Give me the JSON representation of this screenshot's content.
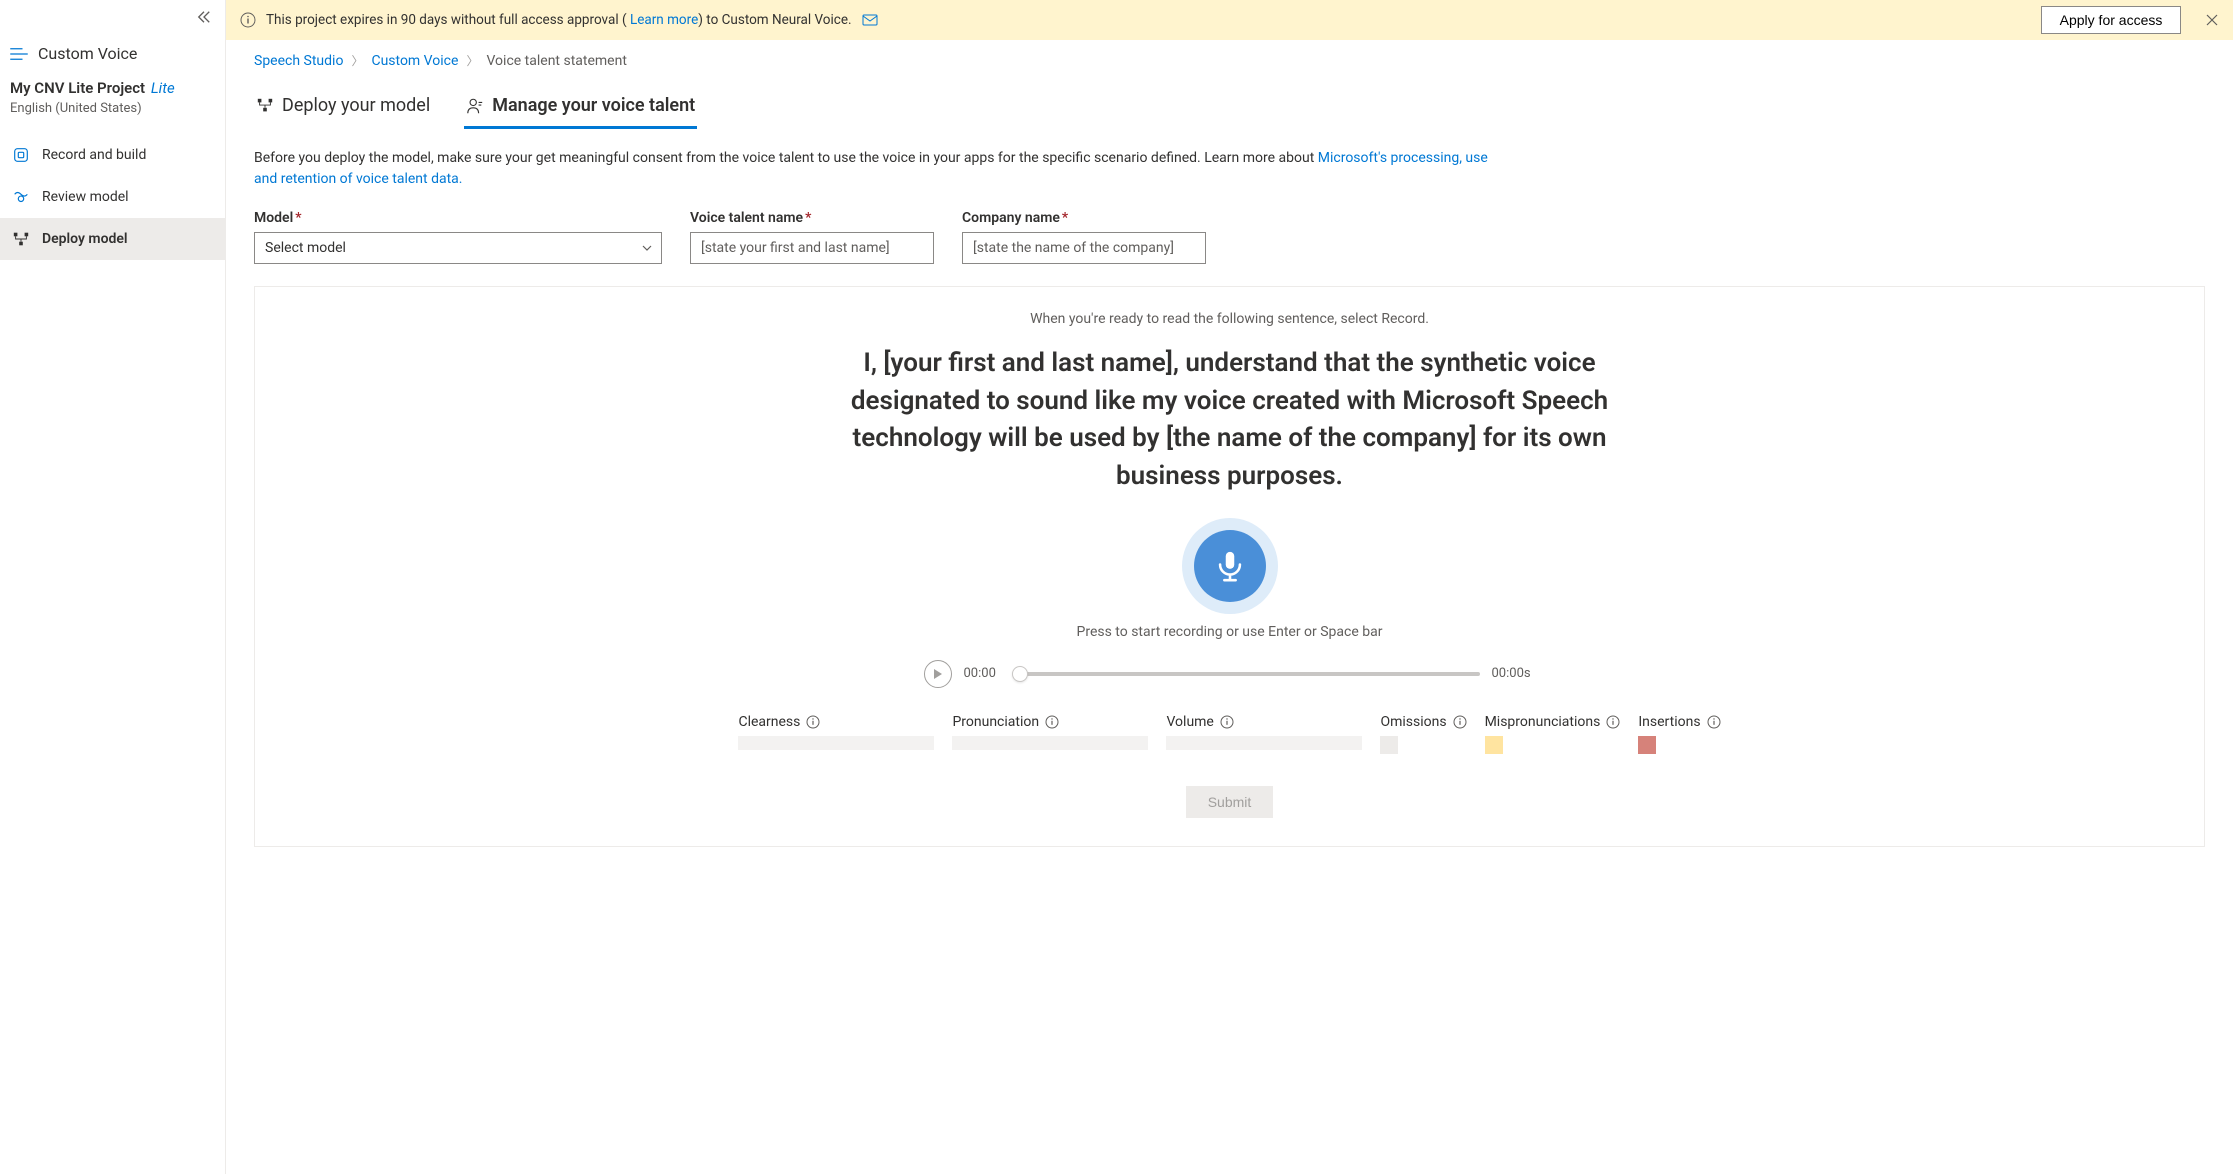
{
  "sidebar": {
    "app_name": "Custom Voice",
    "project_name": "My CNV Lite Project",
    "project_badge": "Lite",
    "project_lang": "English (United States)",
    "nav": [
      {
        "label": "Record and build",
        "id": "record"
      },
      {
        "label": "Review model",
        "id": "review"
      },
      {
        "label": "Deploy model",
        "id": "deploy"
      }
    ]
  },
  "banner": {
    "text_pre": "This project expires in 90 days without full access approval ( ",
    "learn_more": "Learn more",
    "text_post": ") to Custom Neural Voice.",
    "apply": "Apply for access"
  },
  "breadcrumb": {
    "items": [
      "Speech Studio",
      "Custom Voice",
      "Voice talent statement"
    ]
  },
  "tabs": {
    "deploy": "Deploy your model",
    "manage": "Manage your voice talent"
  },
  "intro": {
    "text": "Before you deploy the model, make sure your get meaningful consent from the voice talent to use the voice in your apps for the specific scenario defined. Learn more about ",
    "link": "Microsoft's processing, use and retention of voice talent data."
  },
  "form": {
    "model_label": "Model",
    "model_placeholder": "Select model",
    "talent_label": "Voice talent name",
    "talent_placeholder": "[state your first and last name]",
    "company_label": "Company name",
    "company_placeholder": "[state the name of the company]"
  },
  "record": {
    "instruction": "When you're ready to read the following sentence, select Record.",
    "statement": "I, [your first and last name], understand that the synthetic voice designated to sound like my voice created with Microsoft Speech technology will be used by [the name of the company] for its own business purposes.",
    "hint": "Press to start recording or use Enter or Space bar",
    "time_current": "00:00",
    "time_total": "00:00s"
  },
  "metrics": {
    "clearness": "Clearness",
    "pronunciation": "Pronunciation",
    "volume": "Volume",
    "omissions": "Omissions",
    "mispronunciations": "Mispronunciations",
    "insertions": "Insertions"
  },
  "submit": "Submit"
}
